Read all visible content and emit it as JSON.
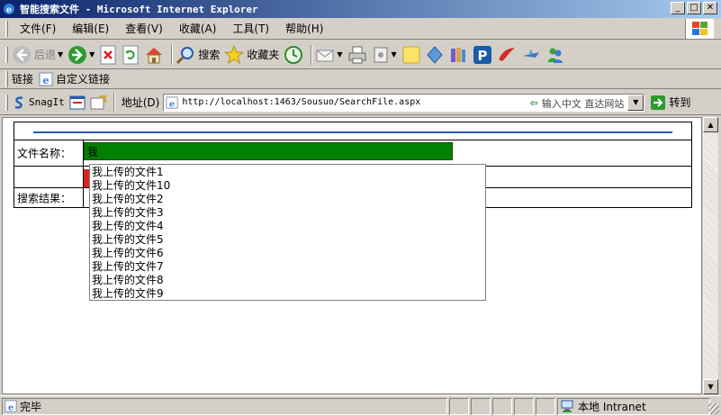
{
  "window": {
    "title": "智能搜索文件 - Microsoft Internet Explorer",
    "minimize": "_",
    "maximize": "□",
    "close": "✕"
  },
  "menu": [
    {
      "label": "文件(F)",
      "name": "menu-file"
    },
    {
      "label": "编辑(E)",
      "name": "menu-edit"
    },
    {
      "label": "查看(V)",
      "name": "menu-view"
    },
    {
      "label": "收藏(A)",
      "name": "menu-favorites"
    },
    {
      "label": "工具(T)",
      "name": "menu-tools"
    },
    {
      "label": "帮助(H)",
      "name": "menu-help"
    }
  ],
  "toolbar": {
    "back_label": "后退",
    "search_label": "搜索",
    "favorites_label": "收藏夹"
  },
  "links": {
    "label": "链接",
    "custom_label": "自定义链接"
  },
  "address": {
    "snagit_label": "SnagIt",
    "label": "地址(D)",
    "url": "http://localhost:1463/Sousuo/SearchFile.aspx",
    "search_hint": "输入中文 直达网站",
    "go_label": "转到"
  },
  "form": {
    "file_name_label": "文件名称：",
    "file_name_value": "我",
    "results_label": "搜索结果："
  },
  "autocomplete": [
    "我上传的文件1",
    "我上传的文件10",
    "我上传的文件2",
    "我上传的文件3",
    "我上传的文件4",
    "我上传的文件5",
    "我上传的文件6",
    "我上传的文件7",
    "我上传的文件8",
    "我上传的文件9"
  ],
  "status": {
    "text": "完毕",
    "zone": "本地 Intranet"
  },
  "colors": {
    "input_bg": "#008000",
    "button_red": "#e0201e",
    "divider_blue": "#1f5fa6",
    "title_bar": "#0a246a"
  }
}
